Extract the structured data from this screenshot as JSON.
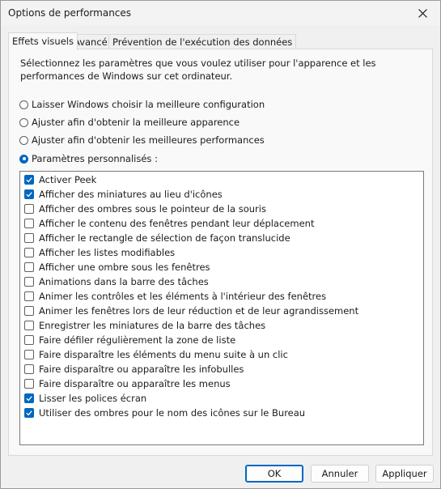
{
  "window": {
    "title": "Options de performances"
  },
  "tabs": [
    {
      "label": "Effets visuels",
      "active": true
    },
    {
      "label": "Avancé",
      "active": false
    },
    {
      "label": "Prévention de l'exécution des données",
      "active": false
    }
  ],
  "description": "Sélectionnez les paramètres que vous voulez utiliser pour l'apparence et les performances de Windows sur cet ordinateur.",
  "radios": [
    {
      "label": "Laisser Windows choisir la meilleure configuration",
      "checked": false
    },
    {
      "label": "Ajuster afin d'obtenir la meilleure apparence",
      "checked": false
    },
    {
      "label": "Ajuster afin d'obtenir les meilleures performances",
      "checked": false
    },
    {
      "label": "Paramètres personnalisés :",
      "checked": true
    }
  ],
  "options": [
    {
      "label": "Activer Peek",
      "checked": true
    },
    {
      "label": "Afficher des miniatures au lieu d'icônes",
      "checked": true
    },
    {
      "label": "Afficher des ombres sous le pointeur de la souris",
      "checked": false
    },
    {
      "label": "Afficher le contenu des fenêtres pendant leur déplacement",
      "checked": false
    },
    {
      "label": "Afficher le rectangle de sélection de façon translucide",
      "checked": false
    },
    {
      "label": "Afficher les listes modifiables",
      "checked": false
    },
    {
      "label": "Afficher une ombre sous les fenêtres",
      "checked": false
    },
    {
      "label": "Animations dans la barre des tâches",
      "checked": false
    },
    {
      "label": "Animer les contrôles et les éléments à l'intérieur des fenêtres",
      "checked": false
    },
    {
      "label": "Animer les fenêtres lors de leur réduction et de leur agrandissement",
      "checked": false
    },
    {
      "label": "Enregistrer les miniatures de la barre des tâches",
      "checked": false
    },
    {
      "label": "Faire défiler régulièrement la zone de liste",
      "checked": false
    },
    {
      "label": "Faire disparaître les éléments du menu suite à un clic",
      "checked": false
    },
    {
      "label": "Faire disparaître ou apparaître les infobulles",
      "checked": false
    },
    {
      "label": "Faire disparaître ou apparaître les menus",
      "checked": false
    },
    {
      "label": "Lisser les polices écran",
      "checked": true
    },
    {
      "label": "Utiliser des ombres pour le nom des icônes sur le Bureau",
      "checked": true
    }
  ],
  "buttons": {
    "ok": "OK",
    "cancel": "Annuler",
    "apply": "Appliquer"
  },
  "colors": {
    "accent": "#0067c0"
  }
}
